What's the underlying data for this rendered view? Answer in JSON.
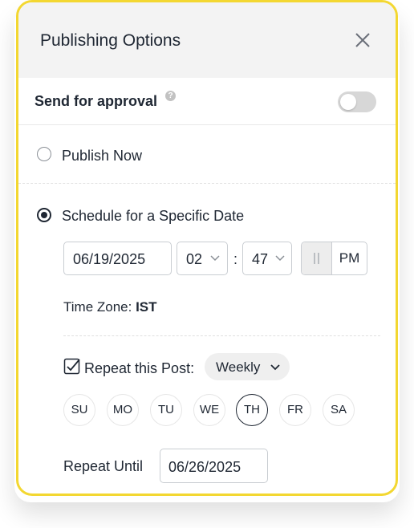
{
  "dialog": {
    "title": "Publishing Options",
    "close_icon": "close-icon"
  },
  "approval": {
    "label": "Send for approval",
    "help_icon": "help-icon",
    "help_glyph": "?",
    "enabled": false
  },
  "publish_options": {
    "publish_now_label": "Publish Now",
    "schedule_label": "Schedule for a Specific Date",
    "selected": "schedule"
  },
  "schedule": {
    "date": "06/19/2025",
    "hour": "02",
    "minute": "47",
    "separator": ":",
    "am_pm": "PM",
    "timezone_label": "Time Zone:",
    "timezone": "IST"
  },
  "repeat": {
    "checked": true,
    "label": "Repeat this Post:",
    "frequency": "Weekly",
    "days": [
      "SU",
      "MO",
      "TU",
      "WE",
      "TH",
      "FR",
      "SA"
    ],
    "selected_day": "TH",
    "until_label": "Repeat Until",
    "until_date": "06/26/2025"
  },
  "colors": {
    "accent_border": "#f3d731",
    "text": "#1f2733",
    "header_bg": "#f3f3f3",
    "toggle_off": "#d7d7d7"
  }
}
